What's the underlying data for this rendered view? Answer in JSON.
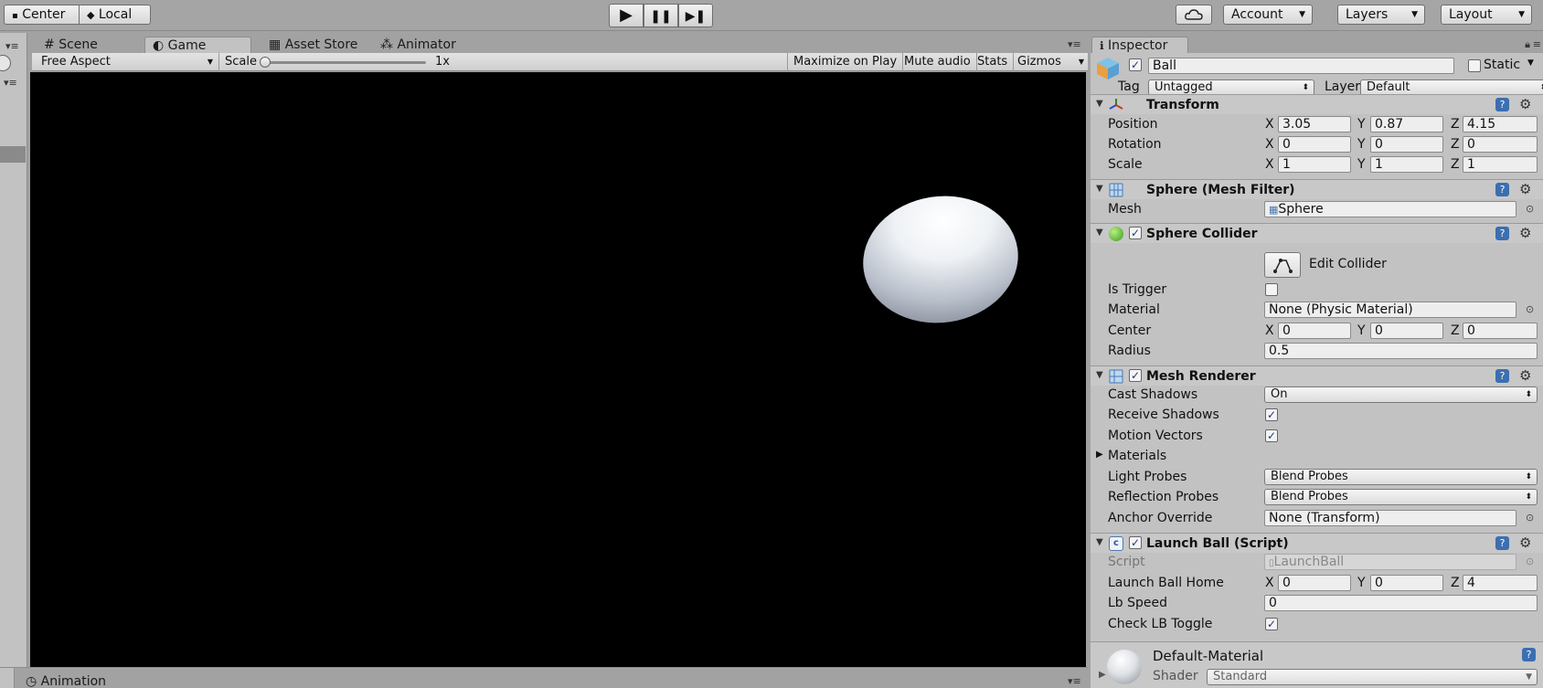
{
  "toolbar": {
    "pivot_label": "Center",
    "space_label": "Local",
    "play_icon": "▶",
    "pause_icon": "❚❚",
    "step_icon": "▶❚",
    "cloud_icon": "cloud-icon",
    "account_label": "Account",
    "layers_label": "Layers",
    "layout_label": "Layout"
  },
  "tabs": [
    {
      "label": "Scene",
      "icon": "#"
    },
    {
      "label": "Game",
      "icon": "◐"
    },
    {
      "label": "Asset Store",
      "icon": "▦"
    },
    {
      "label": "Animator",
      "icon": "⁂"
    }
  ],
  "game_bar": {
    "aspect": "Free Aspect",
    "scale_label": "Scale",
    "scale_value": "1x",
    "maximize": "Maximize on Play",
    "mute": "Mute audio",
    "stats": "Stats",
    "gizmos": "Gizmos"
  },
  "bottom_tab": {
    "label": "Animation"
  },
  "inspector": {
    "tab_label": "Inspector",
    "object": {
      "active": true,
      "name": "Ball",
      "static_label": "Static",
      "tag_label": "Tag",
      "tag_value": "Untagged",
      "layer_label": "Layer",
      "layer_value": "Default"
    },
    "transform": {
      "title": "Transform",
      "position": {
        "label": "Position",
        "x": "3.05",
        "y": "0.87",
        "z": "4.15"
      },
      "rotation": {
        "label": "Rotation",
        "x": "0",
        "y": "0",
        "z": "0"
      },
      "scale": {
        "label": "Scale",
        "x": "1",
        "y": "1",
        "z": "1"
      }
    },
    "mesh_filter": {
      "title": "Sphere (Mesh Filter)",
      "mesh_label": "Mesh",
      "mesh_value": "Sphere"
    },
    "sphere_collider": {
      "title": "Sphere Collider",
      "edit_label": "Edit Collider",
      "is_trigger_label": "Is Trigger",
      "is_trigger": false,
      "material_label": "Material",
      "material_value": "None (Physic Material)",
      "center_label": "Center",
      "center": {
        "x": "0",
        "y": "0",
        "z": "0"
      },
      "radius_label": "Radius",
      "radius_value": "0.5"
    },
    "mesh_renderer": {
      "title": "Mesh Renderer",
      "cast_shadows_label": "Cast Shadows",
      "cast_shadows_value": "On",
      "receive_shadows_label": "Receive Shadows",
      "motion_vectors_label": "Motion Vectors",
      "materials_label": "Materials",
      "light_probes_label": "Light Probes",
      "light_probes_value": "Blend Probes",
      "reflection_probes_label": "Reflection Probes",
      "reflection_probes_value": "Blend Probes",
      "anchor_override_label": "Anchor Override",
      "anchor_override_value": "None (Transform)"
    },
    "launch_ball": {
      "title": "Launch Ball (Script)",
      "script_label": "Script",
      "script_value": "LaunchBall",
      "home_label": "Launch Ball Home",
      "home": {
        "x": "0",
        "y": "0",
        "z": "4"
      },
      "lb_speed_label": "Lb Speed",
      "lb_speed_value": "0",
      "check_toggle_label": "Check LB Toggle"
    },
    "material": {
      "name": "Default-Material",
      "shader_label": "Shader",
      "shader_value": "Standard"
    },
    "axis": {
      "x": "X",
      "y": "Y",
      "z": "Z"
    }
  }
}
